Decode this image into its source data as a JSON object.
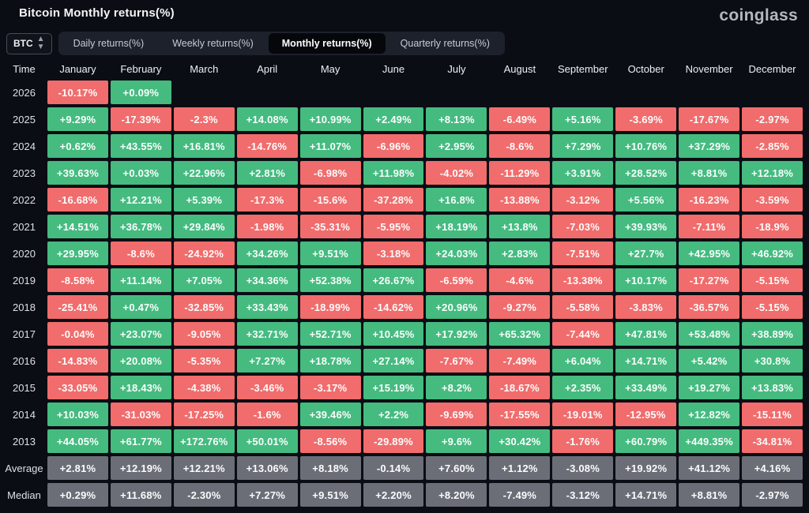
{
  "header": {
    "title": "Bitcoin Monthly returns(%)",
    "logo": "coinglass"
  },
  "controls": {
    "symbol_select": {
      "value": "BTC",
      "icon": "up-down-arrows"
    },
    "tabs": [
      {
        "label": "Daily returns(%)",
        "active": false
      },
      {
        "label": "Weekly returns(%)",
        "active": false
      },
      {
        "label": "Monthly returns(%)",
        "active": true
      },
      {
        "label": "Quarterly returns(%)",
        "active": false
      }
    ]
  },
  "chart_data": {
    "type": "heatmap",
    "title": "Bitcoin Monthly returns(%)",
    "row_header": "Time",
    "columns": [
      "January",
      "February",
      "March",
      "April",
      "May",
      "June",
      "July",
      "August",
      "September",
      "October",
      "November",
      "December"
    ],
    "rows": [
      {
        "label": "2026",
        "summary": false,
        "values": [
          "-10.17%",
          "+0.09%",
          null,
          null,
          null,
          null,
          null,
          null,
          null,
          null,
          null,
          null
        ]
      },
      {
        "label": "2025",
        "summary": false,
        "values": [
          "+9.29%",
          "-17.39%",
          "-2.3%",
          "+14.08%",
          "+10.99%",
          "+2.49%",
          "+8.13%",
          "-6.49%",
          "+5.16%",
          "-3.69%",
          "-17.67%",
          "-2.97%"
        ]
      },
      {
        "label": "2024",
        "summary": false,
        "values": [
          "+0.62%",
          "+43.55%",
          "+16.81%",
          "-14.76%",
          "+11.07%",
          "-6.96%",
          "+2.95%",
          "-8.6%",
          "+7.29%",
          "+10.76%",
          "+37.29%",
          "-2.85%"
        ]
      },
      {
        "label": "2023",
        "summary": false,
        "values": [
          "+39.63%",
          "+0.03%",
          "+22.96%",
          "+2.81%",
          "-6.98%",
          "+11.98%",
          "-4.02%",
          "-11.29%",
          "+3.91%",
          "+28.52%",
          "+8.81%",
          "+12.18%"
        ]
      },
      {
        "label": "2022",
        "summary": false,
        "values": [
          "-16.68%",
          "+12.21%",
          "+5.39%",
          "-17.3%",
          "-15.6%",
          "-37.28%",
          "+16.8%",
          "-13.88%",
          "-3.12%",
          "+5.56%",
          "-16.23%",
          "-3.59%"
        ]
      },
      {
        "label": "2021",
        "summary": false,
        "values": [
          "+14.51%",
          "+36.78%",
          "+29.84%",
          "-1.98%",
          "-35.31%",
          "-5.95%",
          "+18.19%",
          "+13.8%",
          "-7.03%",
          "+39.93%",
          "-7.11%",
          "-18.9%"
        ]
      },
      {
        "label": "2020",
        "summary": false,
        "values": [
          "+29.95%",
          "-8.6%",
          "-24.92%",
          "+34.26%",
          "+9.51%",
          "-3.18%",
          "+24.03%",
          "+2.83%",
          "-7.51%",
          "+27.7%",
          "+42.95%",
          "+46.92%"
        ]
      },
      {
        "label": "2019",
        "summary": false,
        "values": [
          "-8.58%",
          "+11.14%",
          "+7.05%",
          "+34.36%",
          "+52.38%",
          "+26.67%",
          "-6.59%",
          "-4.6%",
          "-13.38%",
          "+10.17%",
          "-17.27%",
          "-5.15%"
        ]
      },
      {
        "label": "2018",
        "summary": false,
        "values": [
          "-25.41%",
          "+0.47%",
          "-32.85%",
          "+33.43%",
          "-18.99%",
          "-14.62%",
          "+20.96%",
          "-9.27%",
          "-5.58%",
          "-3.83%",
          "-36.57%",
          "-5.15%"
        ]
      },
      {
        "label": "2017",
        "summary": false,
        "values": [
          "-0.04%",
          "+23.07%",
          "-9.05%",
          "+32.71%",
          "+52.71%",
          "+10.45%",
          "+17.92%",
          "+65.32%",
          "-7.44%",
          "+47.81%",
          "+53.48%",
          "+38.89%"
        ]
      },
      {
        "label": "2016",
        "summary": false,
        "values": [
          "-14.83%",
          "+20.08%",
          "-5.35%",
          "+7.27%",
          "+18.78%",
          "+27.14%",
          "-7.67%",
          "-7.49%",
          "+6.04%",
          "+14.71%",
          "+5.42%",
          "+30.8%"
        ]
      },
      {
        "label": "2015",
        "summary": false,
        "values": [
          "-33.05%",
          "+18.43%",
          "-4.38%",
          "-3.46%",
          "-3.17%",
          "+15.19%",
          "+8.2%",
          "-18.67%",
          "+2.35%",
          "+33.49%",
          "+19.27%",
          "+13.83%"
        ]
      },
      {
        "label": "2014",
        "summary": false,
        "values": [
          "+10.03%",
          "-31.03%",
          "-17.25%",
          "-1.6%",
          "+39.46%",
          "+2.2%",
          "-9.69%",
          "-17.55%",
          "-19.01%",
          "-12.95%",
          "+12.82%",
          "-15.11%"
        ]
      },
      {
        "label": "2013",
        "summary": false,
        "values": [
          "+44.05%",
          "+61.77%",
          "+172.76%",
          "+50.01%",
          "-8.56%",
          "-29.89%",
          "+9.6%",
          "+30.42%",
          "-1.76%",
          "+60.79%",
          "+449.35%",
          "-34.81%"
        ]
      },
      {
        "label": "Average",
        "summary": true,
        "values": [
          "+2.81%",
          "+12.19%",
          "+12.21%",
          "+13.06%",
          "+8.18%",
          "-0.14%",
          "+7.60%",
          "+1.12%",
          "-3.08%",
          "+19.92%",
          "+41.12%",
          "+4.16%"
        ]
      },
      {
        "label": "Median",
        "summary": true,
        "values": [
          "+0.29%",
          "+11.68%",
          "-2.30%",
          "+7.27%",
          "+9.51%",
          "+2.20%",
          "+8.20%",
          "-7.49%",
          "-3.12%",
          "+14.71%",
          "+8.81%",
          "-2.97%"
        ]
      }
    ],
    "colors": {
      "positive": "#45bb80",
      "negative": "#f16c6c",
      "summary": "#6b6e76",
      "background": "#0a0d13"
    }
  }
}
